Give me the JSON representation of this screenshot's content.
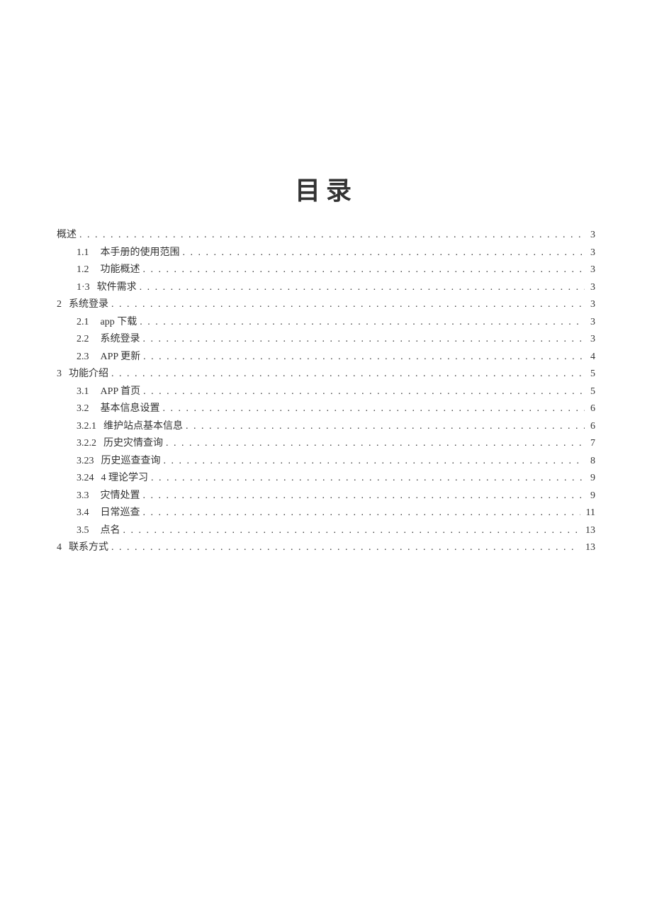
{
  "title": "目录",
  "entries": [
    {
      "level": 1,
      "num": "",
      "text": "概述",
      "page": "3"
    },
    {
      "level": 2,
      "num": "1.1",
      "text": "本手册的使用范围",
      "page": "3"
    },
    {
      "level": 2,
      "num": "1.2",
      "text": "功能概述",
      "page": "3"
    },
    {
      "level": 2,
      "num": "1·3",
      "text": "软件需求",
      "page": "3"
    },
    {
      "level": 1,
      "num": "2",
      "text": "系统登录",
      "page": "3"
    },
    {
      "level": 2,
      "num": "2.1",
      "text": "app 下载",
      "page": "3"
    },
    {
      "level": 2,
      "num": "2.2",
      "text": "系统登录",
      "page": "3"
    },
    {
      "level": 2,
      "num": "2.3",
      "text": "APP 更新",
      "page": "4"
    },
    {
      "level": 1,
      "num": "3",
      "text": "功能介绍",
      "page": "5"
    },
    {
      "level": 2,
      "num": "3.1",
      "text": "APP 首页",
      "page": "5"
    },
    {
      "level": 2,
      "num": "3.2",
      "text": "基本信息设置",
      "page": "6"
    },
    {
      "level": 3,
      "num": "3.2.1",
      "text": "维护站点基本信息",
      "page": "6"
    },
    {
      "level": 3,
      "num": "3.2.2",
      "text": "历史灾情查询",
      "page": "7"
    },
    {
      "level": 3,
      "num": "3.23",
      "text": "历史巡查查询",
      "page": "8"
    },
    {
      "level": 3,
      "num": "3.24",
      "text": "4 理论学习",
      "page": "9"
    },
    {
      "level": 2,
      "num": "3.3",
      "text": "灾情处置",
      "page": "9"
    },
    {
      "level": 2,
      "num": "3.4",
      "text": "日常巡查",
      "page": "11"
    },
    {
      "level": 2,
      "num": "3.5",
      "text": "点名",
      "page": "13"
    },
    {
      "level": 1,
      "num": "4",
      "text": "联系方式",
      "page": "13"
    }
  ]
}
